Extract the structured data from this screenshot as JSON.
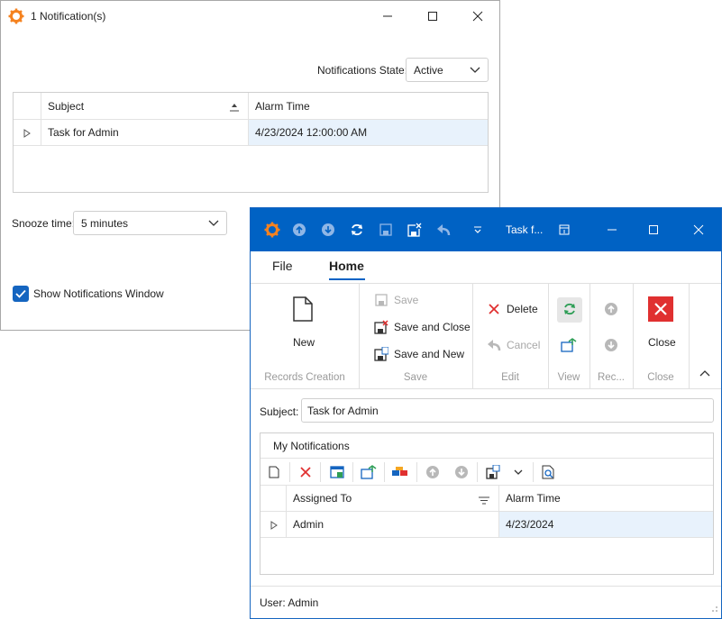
{
  "notification_window": {
    "title": "1 Notification(s)",
    "state_label": "Notifications State:",
    "state_value": "Active",
    "grid": {
      "columns": [
        "Subject",
        "Alarm Time"
      ],
      "rows": [
        {
          "subject": "Task for Admin",
          "alarm_time": "4/23/2024 12:00:00 AM"
        }
      ]
    },
    "snooze_label": "Snooze time:",
    "snooze_value": "5 minutes",
    "show_window_label": "Show Notifications Window",
    "show_window_checked": true
  },
  "task_window": {
    "title": "Task f...",
    "tabs": [
      "File",
      "Home"
    ],
    "active_tab": "Home",
    "ribbon": {
      "records_creation": {
        "new_label": "New",
        "group_label": "Records Creation"
      },
      "save": {
        "save_label": "Save",
        "save_close_label": "Save and Close",
        "save_new_label": "Save and New",
        "group_label": "Save"
      },
      "edit": {
        "delete_label": "Delete",
        "cancel_label": "Cancel",
        "group_label": "Edit"
      },
      "view": {
        "group_label": "View"
      },
      "records": {
        "group_label": "Rec..."
      },
      "close": {
        "close_label": "Close",
        "group_label": "Close"
      }
    },
    "subject_label": "Subject:",
    "subject_value": "Task for Admin",
    "notifications_panel": {
      "title": "My Notifications",
      "columns": [
        "Assigned To",
        "Alarm Time"
      ],
      "rows": [
        {
          "assigned_to": "Admin",
          "alarm_time": "4/23/2024"
        }
      ]
    },
    "status": "User: Admin"
  },
  "colors": {
    "accent": "#0062c4",
    "gear": "#f5821f",
    "delete_red": "#e03030",
    "refresh_green": "#2e9e56"
  }
}
